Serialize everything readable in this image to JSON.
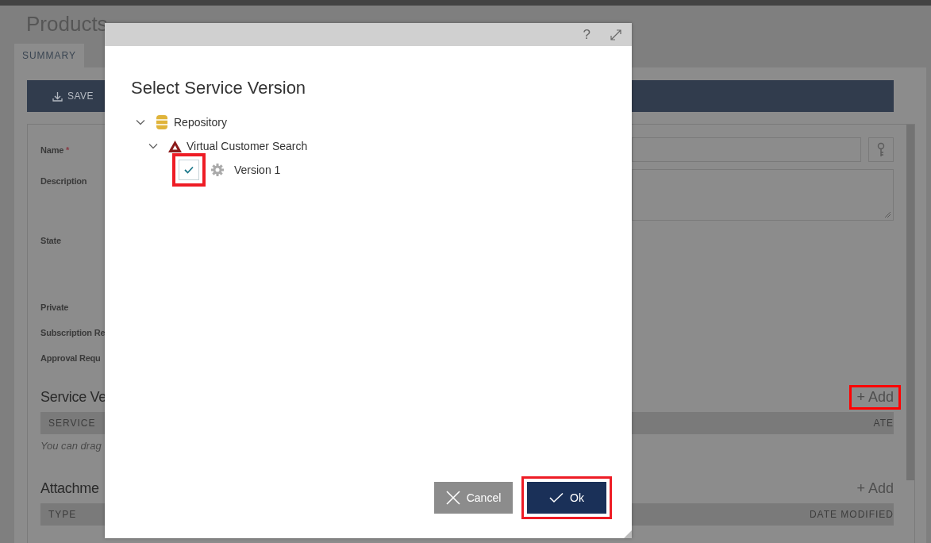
{
  "page": {
    "title": "Products",
    "tabs": [
      {
        "label": "SUMMARY",
        "selected": true
      }
    ],
    "toolbar": {
      "save_button": "SAVE"
    },
    "fields": [
      {
        "label": "Name",
        "marker": "*",
        "kind": "input"
      },
      {
        "label": "Description",
        "kind": "textarea"
      },
      {
        "label": "State",
        "kind": "state"
      },
      {
        "label": "Private",
        "kind": "flag"
      },
      {
        "label": "Subscription Re",
        "kind": "flag"
      },
      {
        "label": "Approval Requ",
        "kind": "flag"
      }
    ],
    "sections": [
      {
        "heading": "Service Ve",
        "add": "+ Add",
        "highlighted": true,
        "columns": [
          "SERVICE",
          "ATE"
        ],
        "note": "You can drag"
      },
      {
        "heading": "Attachme",
        "add": "+ Add",
        "highlighted": false,
        "columns": [
          "TYPE",
          "DATE MODIFIED"
        ]
      }
    ]
  },
  "dialog": {
    "help": "?",
    "title": "Select Service Version",
    "tree": [
      {
        "label": "Repository",
        "kind": "repository",
        "expanded": true,
        "children": [
          {
            "label": "Virtual Customer Search",
            "kind": "service",
            "expanded": true,
            "children": [
              {
                "label": "Version 1",
                "kind": "version",
                "checked": true,
                "highlighted": true
              }
            ]
          }
        ]
      }
    ],
    "buttons": [
      {
        "label": "Cancel",
        "kind": "cancel",
        "highlighted": false
      },
      {
        "label": "Ok",
        "kind": "ok",
        "highlighted": true
      }
    ]
  }
}
